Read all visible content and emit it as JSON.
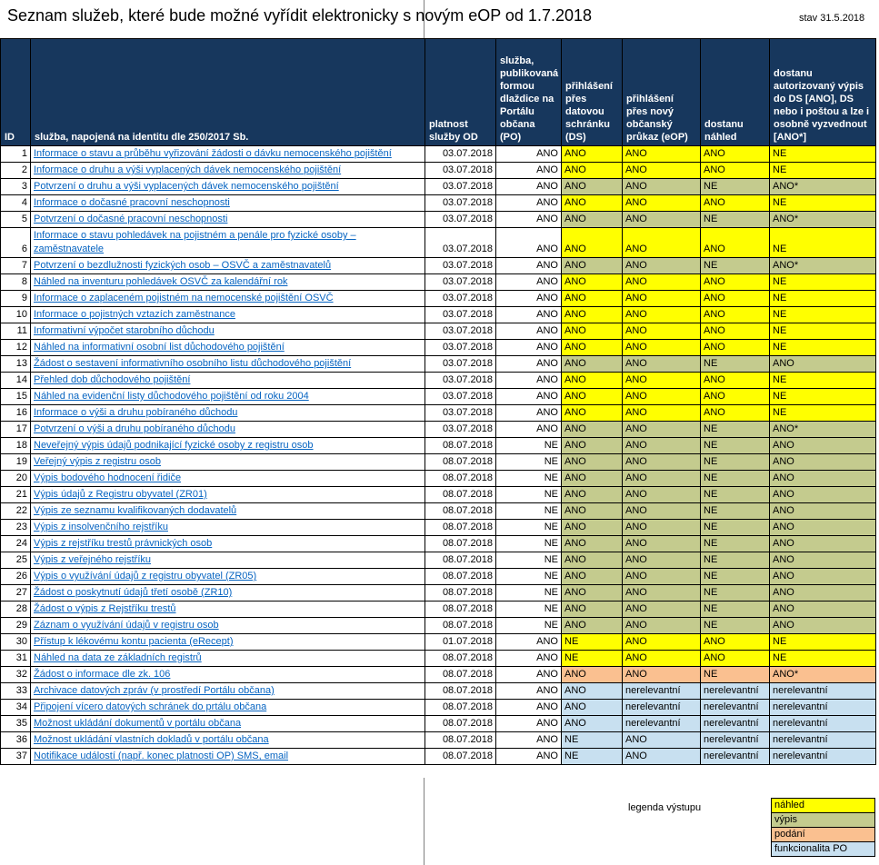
{
  "title": "Seznam služeb, které bude možné vyřídit elektronicky s novým eOP od 1.7.2018",
  "status_date": "stav 31.5.2018",
  "colors": {
    "header_bg": "#17375D",
    "link": "#0563C1",
    "nahled": "#FFFF00",
    "vypis": "#C4CB8E",
    "podani": "#FAC090",
    "funkcionalita": "#C8E0F0"
  },
  "table": {
    "headers": {
      "id": "ID",
      "service": "služba, napojená na identitu dle 250/2017 Sb.",
      "valid_from": "platnost služby OD",
      "po": "služba, publikovaná formou dlaždice na Portálu občana (PO)",
      "ds": "přihlášení přes datovou schránku (DS)",
      "eop": "přihlášení přes nový občanský průkaz (eOP)",
      "preview": "dostanu náhled",
      "extract": "dostanu autorizovaný výpis do DS [ANO], DS nebo i poštou a lze i osobně vyzvednout [ANO*]"
    },
    "rows": [
      {
        "id": 1,
        "service": "Informace o stavu a průběhu vyřizování žádosti o dávku nemocenského pojištění",
        "valid_from": "03.07.2018",
        "po": "ANO",
        "ds": "ANO",
        "eop": "ANO",
        "preview": "ANO",
        "extract": "NE",
        "category": "nahled"
      },
      {
        "id": 2,
        "service": "Informace o druhu a výši vyplacených dávek nemocenského pojištění",
        "valid_from": "03.07.2018",
        "po": "ANO",
        "ds": "ANO",
        "eop": "ANO",
        "preview": "ANO",
        "extract": "NE",
        "category": "nahled"
      },
      {
        "id": 3,
        "service": "Potvrzení o druhu a výši vyplacených dávek nemocenského pojištění",
        "valid_from": "03.07.2018",
        "po": "ANO",
        "ds": "ANO",
        "eop": "ANO",
        "preview": "NE",
        "extract": "ANO*",
        "category": "vypis"
      },
      {
        "id": 4,
        "service": "Informace o dočasné pracovní neschopnosti",
        "valid_from": "03.07.2018",
        "po": "ANO",
        "ds": "ANO",
        "eop": "ANO",
        "preview": "ANO",
        "extract": "NE",
        "category": "nahled"
      },
      {
        "id": 5,
        "service": "Potvrzení o dočasné pracovní neschopnosti",
        "valid_from": "03.07.2018",
        "po": "ANO",
        "ds": "ANO",
        "eop": "ANO",
        "preview": "NE",
        "extract": "ANO*",
        "category": "vypis"
      },
      {
        "id": 6,
        "service": "Informace o stavu pohledávek na pojistném a penále pro fyzické osoby – zaměstnavatele",
        "valid_from": "03.07.2018",
        "po": "ANO",
        "ds": "ANO",
        "eop": "ANO",
        "preview": "ANO",
        "extract": "NE",
        "category": "nahled"
      },
      {
        "id": 7,
        "service": "Potvrzení o bezdlužnosti fyzických osob – OSVČ a zaměstnavatelů",
        "valid_from": "03.07.2018",
        "po": "ANO",
        "ds": "ANO",
        "eop": "ANO",
        "preview": "NE",
        "extract": "ANO*",
        "category": "vypis"
      },
      {
        "id": 8,
        "service": "Náhled na inventuru pohledávek OSVČ za kalendářní rok",
        "valid_from": "03.07.2018",
        "po": "ANO",
        "ds": "ANO",
        "eop": "ANO",
        "preview": "ANO",
        "extract": "NE",
        "category": "nahled"
      },
      {
        "id": 9,
        "service": "Informace o zaplaceném pojistném na nemocenské pojištění OSVČ",
        "valid_from": "03.07.2018",
        "po": "ANO",
        "ds": "ANO",
        "eop": "ANO",
        "preview": "ANO",
        "extract": "NE",
        "category": "nahled"
      },
      {
        "id": 10,
        "service": "Informace o pojistných vztazích zaměstnance",
        "valid_from": "03.07.2018",
        "po": "ANO",
        "ds": "ANO",
        "eop": "ANO",
        "preview": "ANO",
        "extract": "NE",
        "category": "nahled"
      },
      {
        "id": 11,
        "service": "Informativní výpočet starobního důchodu",
        "valid_from": "03.07.2018",
        "po": "ANO",
        "ds": "ANO",
        "eop": "ANO",
        "preview": "ANO",
        "extract": "NE",
        "category": "nahled"
      },
      {
        "id": 12,
        "service": "Náhled na informativní osobní list důchodového pojištění",
        "valid_from": "03.07.2018",
        "po": "ANO",
        "ds": "ANO",
        "eop": "ANO",
        "preview": "ANO",
        "extract": "NE",
        "category": "nahled"
      },
      {
        "id": 13,
        "service": "Žádost o sestavení informativního osobního listu důchodového pojištění",
        "valid_from": "03.07.2018",
        "po": "ANO",
        "ds": "ANO",
        "eop": "ANO",
        "preview": "NE",
        "extract": "ANO",
        "category": "vypis"
      },
      {
        "id": 14,
        "service": "Přehled dob důchodového pojištění",
        "valid_from": "03.07.2018",
        "po": "ANO",
        "ds": "ANO",
        "eop": "ANO",
        "preview": "ANO",
        "extract": "NE",
        "category": "nahled"
      },
      {
        "id": 15,
        "service": "Náhled na evidenční listy důchodového pojištění od roku 2004",
        "valid_from": "03.07.2018",
        "po": "ANO",
        "ds": "ANO",
        "eop": "ANO",
        "preview": "ANO",
        "extract": "NE",
        "category": "nahled"
      },
      {
        "id": 16,
        "service": "Informace o výši a druhu pobíraného důchodu",
        "valid_from": "03.07.2018",
        "po": "ANO",
        "ds": "ANO",
        "eop": "ANO",
        "preview": "ANO",
        "extract": "NE",
        "category": "nahled"
      },
      {
        "id": 17,
        "service": "Potvrzení o výši a druhu pobíraného důchodu",
        "valid_from": "03.07.2018",
        "po": "ANO",
        "ds": "ANO",
        "eop": "ANO",
        "preview": "NE",
        "extract": "ANO*",
        "category": "vypis"
      },
      {
        "id": 18,
        "service": "Neveřejný výpis údajů podnikající fyzické osoby z registru osob",
        "valid_from": "08.07.2018",
        "po": "NE",
        "ds": "ANO",
        "eop": "ANO",
        "preview": "NE",
        "extract": "ANO",
        "category": "vypis"
      },
      {
        "id": 19,
        "service": "Veřejný výpis z registru osob",
        "valid_from": "08.07.2018",
        "po": "NE",
        "ds": "ANO",
        "eop": "ANO",
        "preview": "NE",
        "extract": "ANO",
        "category": "vypis"
      },
      {
        "id": 20,
        "service": "Výpis bodového hodnocení řidiče",
        "valid_from": "08.07.2018",
        "po": "NE",
        "ds": "ANO",
        "eop": "ANO",
        "preview": "NE",
        "extract": "ANO",
        "category": "vypis"
      },
      {
        "id": 21,
        "service": "Výpis údajů z Registru obyvatel (ZR01)",
        "valid_from": "08.07.2018",
        "po": "NE",
        "ds": "ANO",
        "eop": "ANO",
        "preview": "NE",
        "extract": "ANO",
        "category": "vypis"
      },
      {
        "id": 22,
        "service": "Výpis ze seznamu kvalifikovaných dodavatelů",
        "valid_from": "08.07.2018",
        "po": "NE",
        "ds": "ANO",
        "eop": "ANO",
        "preview": "NE",
        "extract": "ANO",
        "category": "vypis"
      },
      {
        "id": 23,
        "service": "Výpis z insolvenčního rejstříku",
        "valid_from": "08.07.2018",
        "po": "NE",
        "ds": "ANO",
        "eop": "ANO",
        "preview": "NE",
        "extract": "ANO",
        "category": "vypis"
      },
      {
        "id": 24,
        "service": "Výpis z rejstříku trestů právnických osob",
        "valid_from": "08.07.2018",
        "po": "NE",
        "ds": "ANO",
        "eop": "ANO",
        "preview": "NE",
        "extract": "ANO",
        "category": "vypis"
      },
      {
        "id": 25,
        "service": "Výpis z veřejného rejstříku",
        "valid_from": "08.07.2018",
        "po": "NE",
        "ds": "ANO",
        "eop": "ANO",
        "preview": "NE",
        "extract": "ANO",
        "category": "vypis"
      },
      {
        "id": 26,
        "service": "Výpis o využívání údajů z registru obyvatel (ZR05)",
        "valid_from": "08.07.2018",
        "po": "NE",
        "ds": "ANO",
        "eop": "ANO",
        "preview": "NE",
        "extract": "ANO",
        "category": "vypis"
      },
      {
        "id": 27,
        "service": "Žádost o poskytnutí údajů třetí osobě (ZR10)",
        "valid_from": "08.07.2018",
        "po": "NE",
        "ds": "ANO",
        "eop": "ANO",
        "preview": "NE",
        "extract": "ANO",
        "category": "vypis"
      },
      {
        "id": 28,
        "service": "Žádost o výpis z Rejstříku trestů",
        "valid_from": "08.07.2018",
        "po": "NE",
        "ds": "ANO",
        "eop": "ANO",
        "preview": "NE",
        "extract": "ANO",
        "category": "vypis"
      },
      {
        "id": 29,
        "service": "Záznam o využívání údajů v registru osob",
        "valid_from": "08.07.2018",
        "po": "NE",
        "ds": "ANO",
        "eop": "ANO",
        "preview": "NE",
        "extract": "ANO",
        "category": "vypis"
      },
      {
        "id": 30,
        "service": "Přístup k lékovému kontu pacienta (eRecept)",
        "valid_from": "01.07.2018",
        "po": "ANO",
        "ds": "NE",
        "eop": "ANO",
        "preview": "ANO",
        "extract": "NE",
        "category": "nahled"
      },
      {
        "id": 31,
        "service": "Náhled na data ze základních registrů",
        "valid_from": "08.07.2018",
        "po": "ANO",
        "ds": "NE",
        "eop": "ANO",
        "preview": "ANO",
        "extract": "NE",
        "category": "nahled"
      },
      {
        "id": 32,
        "service": "Žádost o informace dle zk. 106",
        "valid_from": "08.07.2018",
        "po": "ANO",
        "ds": "ANO",
        "eop": "ANO",
        "preview": "NE",
        "extract": "ANO*",
        "category": "podani"
      },
      {
        "id": 33,
        "service": "Archivace datových zpráv (v prostředí Portálu občana)",
        "valid_from": "08.07.2018",
        "po": "ANO",
        "ds": "ANO",
        "eop": "nerelevantní",
        "preview": "nerelevantní",
        "extract": "nerelevantní",
        "category": "funkcionalita"
      },
      {
        "id": 34,
        "service": "Připojení vícero datových schránek do prtálu občana",
        "valid_from": "08.07.2018",
        "po": "ANO",
        "ds": "ANO",
        "eop": "nerelevantní",
        "preview": "nerelevantní",
        "extract": "nerelevantní",
        "category": "funkcionalita"
      },
      {
        "id": 35,
        "service": "Možnost ukládání dokumentů v portálu občana",
        "valid_from": "08.07.2018",
        "po": "ANO",
        "ds": "ANO",
        "eop": "nerelevantní",
        "preview": "nerelevantní",
        "extract": "nerelevantní",
        "category": "funkcionalita"
      },
      {
        "id": 36,
        "service": "Možnost ukládání vlastních dokladů v portálu občana",
        "valid_from": "08.07.2018",
        "po": "ANO",
        "ds": "NE",
        "eop": "ANO",
        "preview": "nerelevantní",
        "extract": "nerelevantní",
        "category": "funkcionalita"
      },
      {
        "id": 37,
        "service": "Notifikace událostí (např. konec platnosti OP) SMS, email",
        "valid_from": "08.07.2018",
        "po": "ANO",
        "ds": "NE",
        "eop": "ANO",
        "preview": "nerelevantní",
        "extract": "nerelevantní",
        "category": "funkcionalita"
      }
    ]
  },
  "legend": {
    "label": "legenda výstupu",
    "items": [
      {
        "label": "náhled",
        "category": "nahled"
      },
      {
        "label": "výpis",
        "category": "vypis"
      },
      {
        "label": "podání",
        "category": "podani"
      },
      {
        "label": "funkcionalita PO",
        "category": "funkcionalita"
      }
    ]
  }
}
